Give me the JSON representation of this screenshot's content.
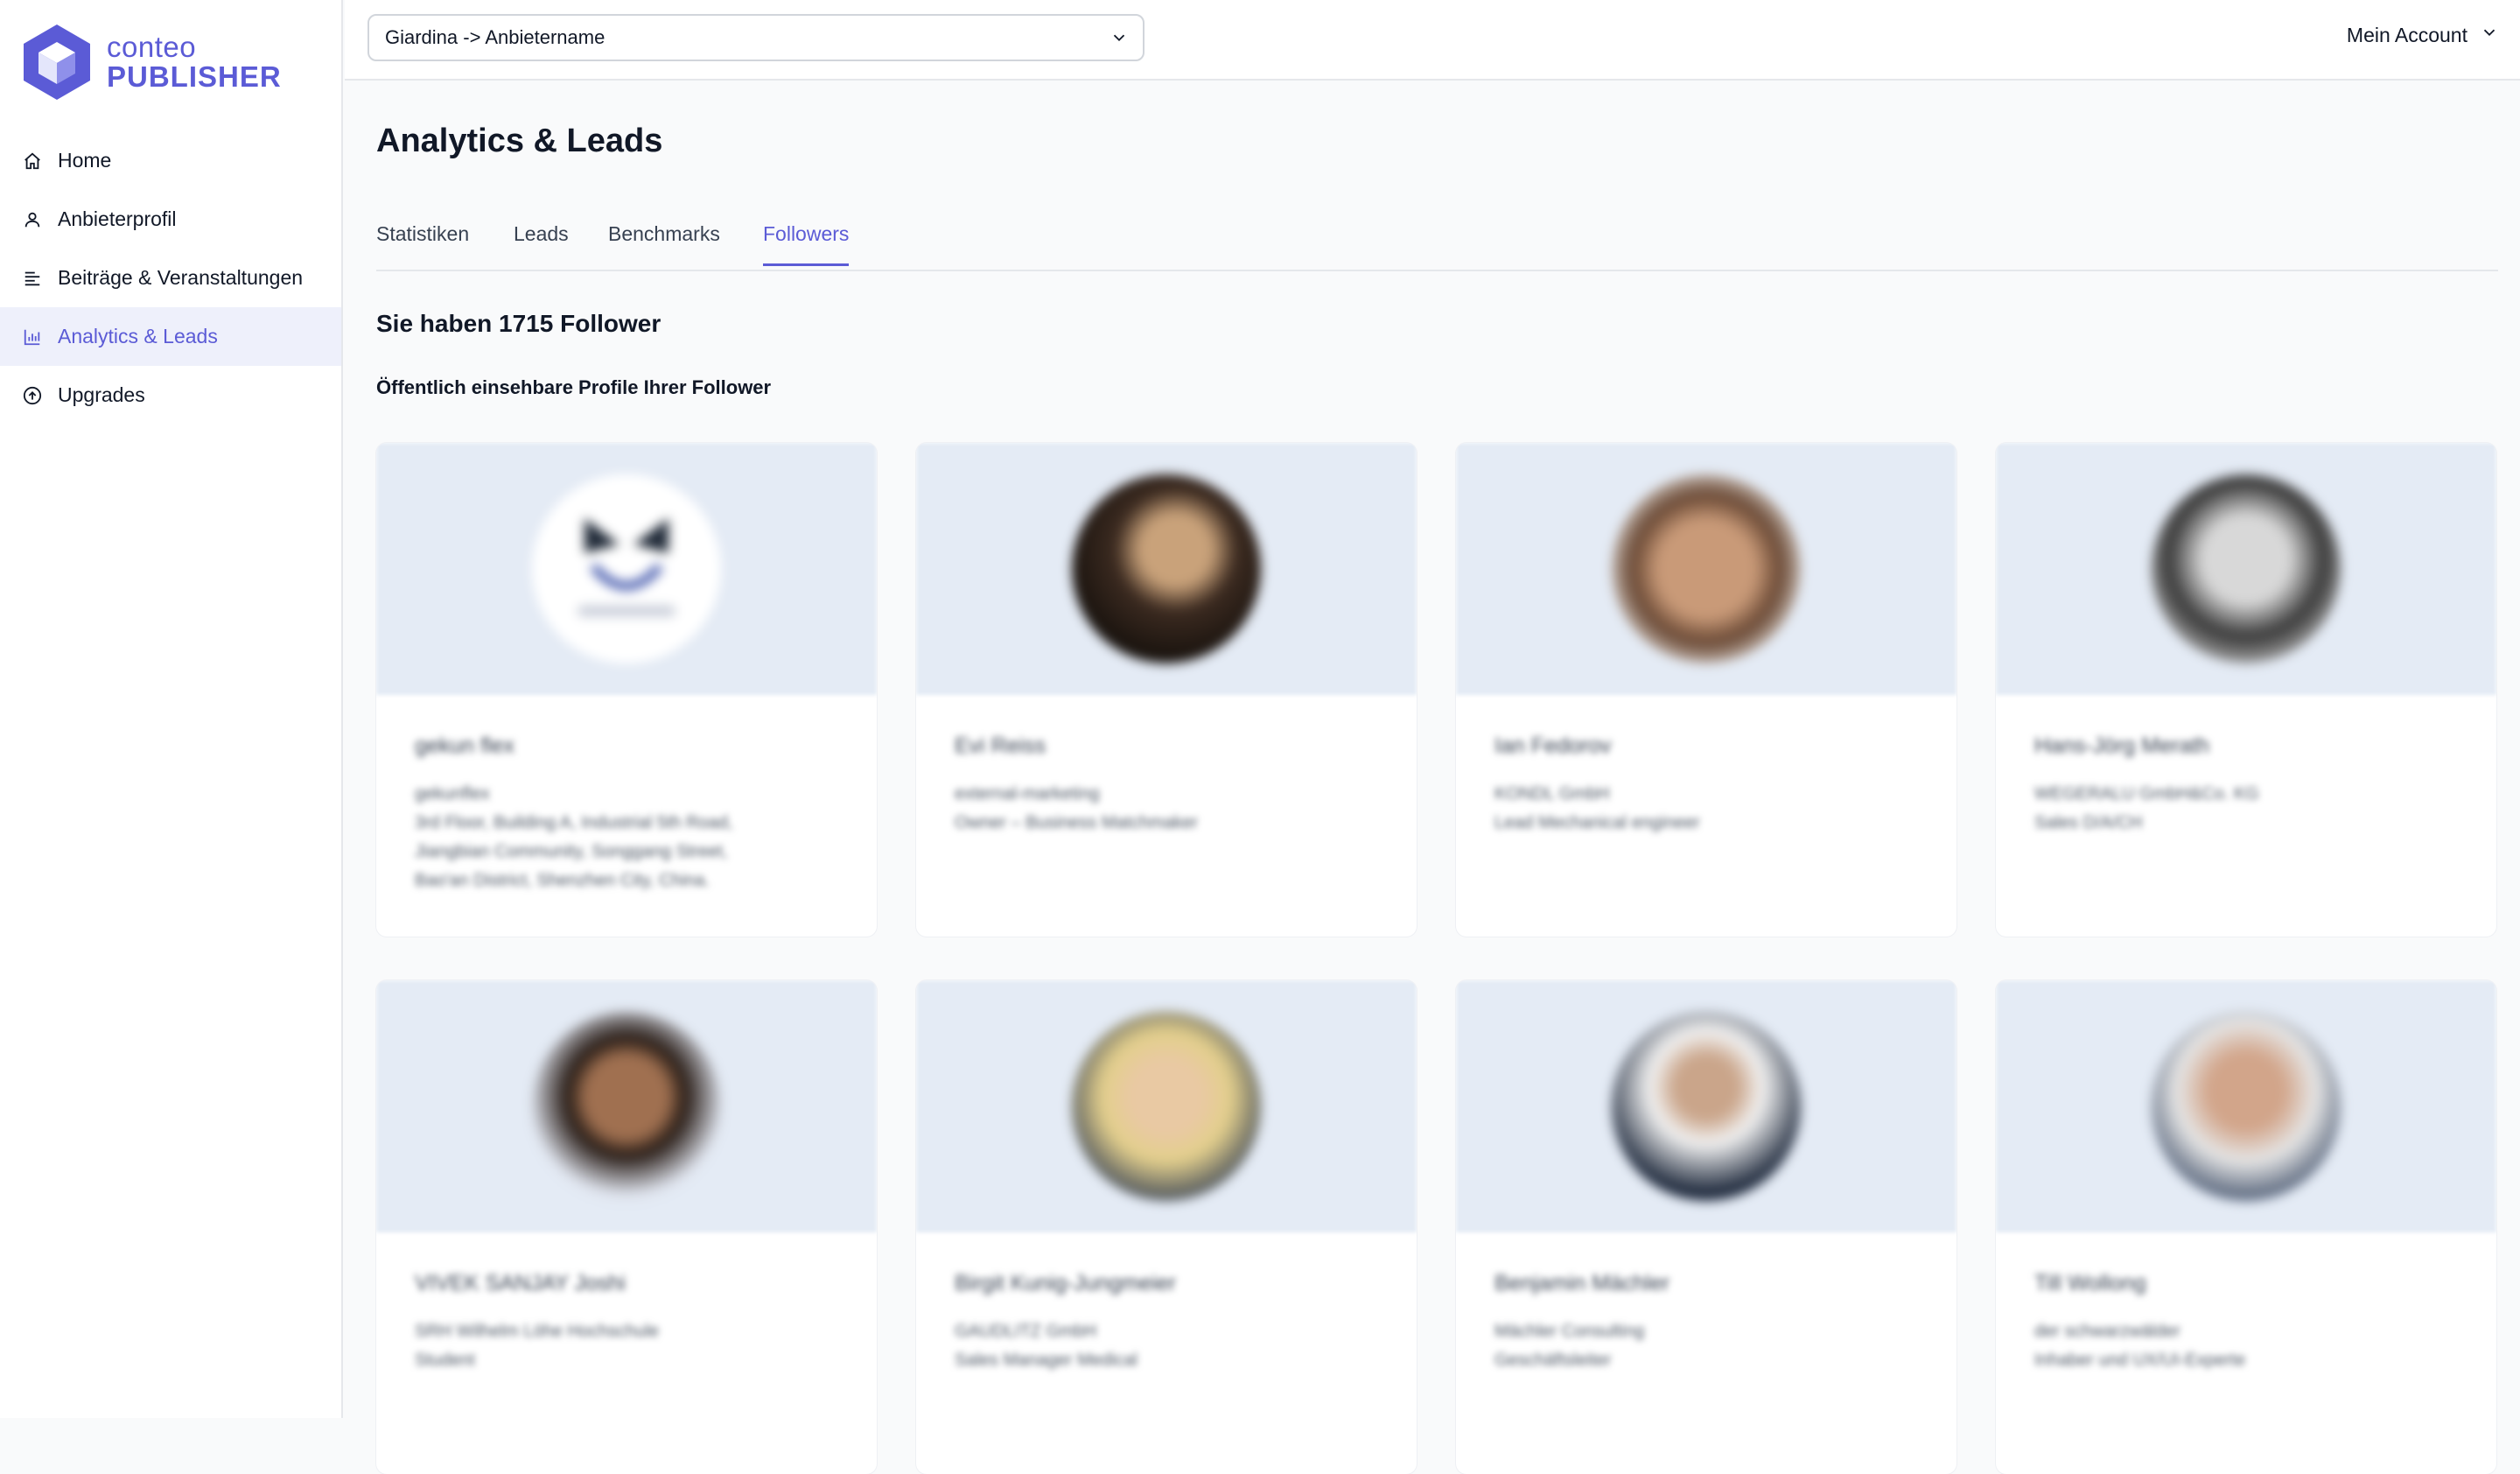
{
  "brand": {
    "line1": "conteo",
    "line2": "PUBLISHER",
    "color": "#5b5bd6"
  },
  "sidebar": {
    "items": [
      {
        "label": "Home",
        "icon": "home-icon",
        "active": false
      },
      {
        "label": "Anbieterprofil",
        "icon": "user-icon",
        "active": false
      },
      {
        "label": "Beiträge & Veranstaltungen",
        "icon": "lines-icon",
        "active": false
      },
      {
        "label": "Analytics & Leads",
        "icon": "chart-icon",
        "active": true
      },
      {
        "label": "Upgrades",
        "icon": "arrow-up-circle-icon",
        "active": false
      }
    ]
  },
  "header": {
    "selector_value": "Giardina -> Anbietername",
    "account_label": "Mein Account"
  },
  "main": {
    "title": "Analytics & Leads",
    "tabs": [
      {
        "label": "Statistiken",
        "active": false
      },
      {
        "label": "Leads",
        "active": false
      },
      {
        "label": "Benchmarks",
        "active": false
      },
      {
        "label": "Followers",
        "active": true
      }
    ],
    "follower_count_text": "Sie haben 1715 Follower",
    "subtitle": "Öffentlich einsehbare Profile Ihrer Follower"
  },
  "followers": [
    {
      "name": "gekun flex",
      "lines": [
        "gekunflex",
        "3rd Floor, Building A, Industrial 5th Road,",
        "Jiangbian Community, Songgang Street,",
        "Bao'an District, Shenzhen City, China."
      ]
    },
    {
      "name": "Evi Reiss",
      "lines": [
        "external-marketing",
        "Owner – Business Matchmaker"
      ]
    },
    {
      "name": "Ian Fedorov",
      "lines": [
        "KONDL GmbH",
        "Lead Mechanical engineer"
      ]
    },
    {
      "name": "Hans-Jörg Merath",
      "lines": [
        "WEGERALU GmbH&Co. KG",
        "Sales D/A/CH"
      ]
    },
    {
      "name": "VIVEK SANJAY Joshi",
      "lines": [
        "SRH Wilhelm Löhe Hochschule",
        "Student"
      ]
    },
    {
      "name": "Birgit Kunig-Jungmeier",
      "lines": [
        "GAUDLITZ GmbH",
        "Sales Manager Medical"
      ]
    },
    {
      "name": "Benjamin Mächler",
      "lines": [
        "Mächler Consulting",
        "Geschäftsleiter"
      ]
    },
    {
      "name": "Till Wollong",
      "lines": [
        "der schwarzwälder",
        "Inhaber und UX/UI-Experte"
      ]
    }
  ]
}
